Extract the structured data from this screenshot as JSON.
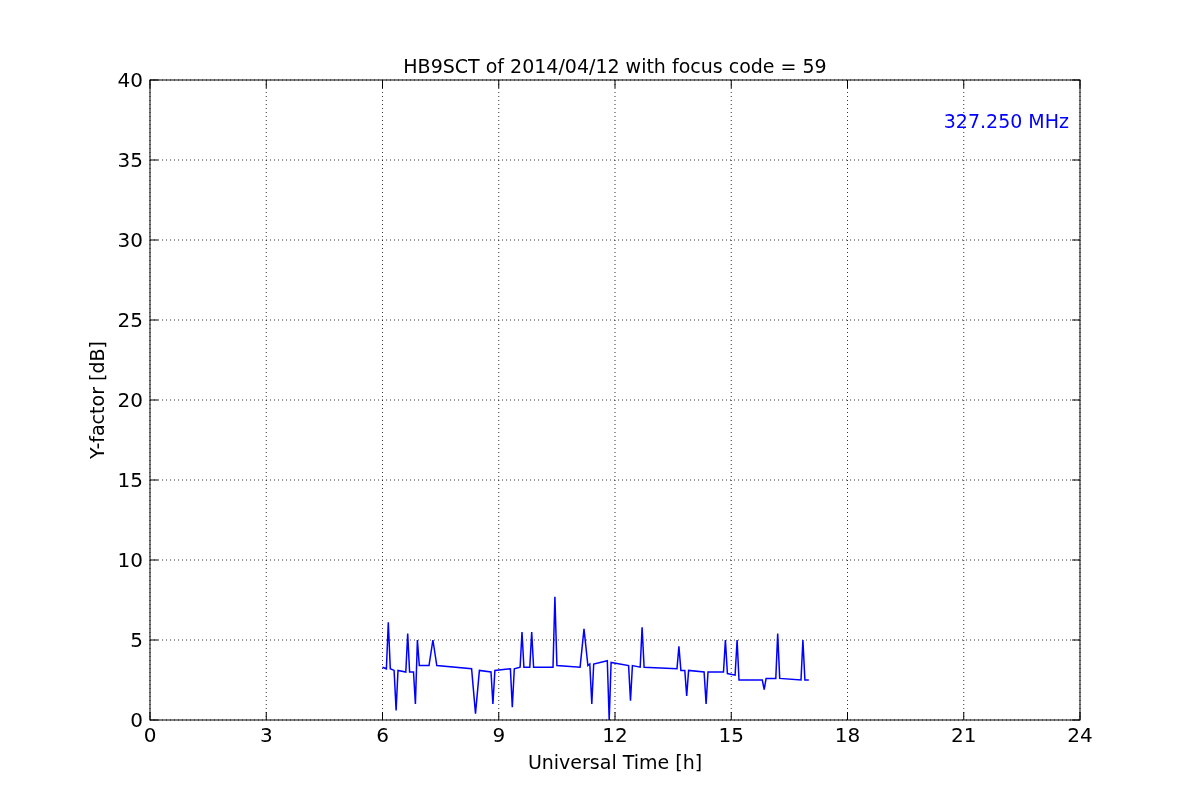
{
  "chart_data": {
    "type": "line",
    "title": "HB9SCT of 2014/04/12 with focus code = 59",
    "xlabel": "Universal Time [h]",
    "ylabel": "Y-factor [dB]",
    "x": [
      6.0,
      6.1,
      6.15,
      6.2,
      6.3,
      6.35,
      6.4,
      6.6,
      6.65,
      6.7,
      6.8,
      6.85,
      6.9,
      6.95,
      7.2,
      7.3,
      7.4,
      8.3,
      8.4,
      8.5,
      8.8,
      8.85,
      8.9,
      9.3,
      9.35,
      9.4,
      9.55,
      9.6,
      9.65,
      9.8,
      9.85,
      9.9,
      10.4,
      10.45,
      10.5,
      11.1,
      11.2,
      11.3,
      11.35,
      11.4,
      11.45,
      11.8,
      11.85,
      11.9,
      12.35,
      12.4,
      12.45,
      12.65,
      12.7,
      12.75,
      13.6,
      13.65,
      13.7,
      13.8,
      13.85,
      13.9,
      14.3,
      14.35,
      14.4,
      14.8,
      14.85,
      14.9,
      15.1,
      15.15,
      15.2,
      15.8,
      15.85,
      15.9,
      16.15,
      16.2,
      16.25,
      16.8,
      16.85,
      16.9,
      17.0
    ],
    "series": [
      {
        "name": "327.250 MHz",
        "color": "#0000ff",
        "values": [
          3.3,
          3.2,
          6.1,
          3.2,
          3.1,
          0.6,
          3.1,
          3.0,
          5.4,
          3.0,
          3.0,
          1.0,
          5.0,
          3.4,
          3.4,
          5.0,
          3.4,
          3.2,
          0.4,
          3.1,
          3.0,
          1.0,
          3.1,
          3.2,
          0.8,
          3.2,
          3.3,
          5.5,
          3.3,
          3.3,
          5.5,
          3.3,
          3.3,
          7.7,
          3.4,
          3.3,
          5.7,
          3.4,
          3.5,
          1.0,
          3.5,
          3.7,
          0.0,
          3.6,
          3.4,
          1.2,
          3.4,
          3.3,
          5.8,
          3.3,
          3.2,
          4.6,
          3.1,
          3.1,
          1.5,
          3.1,
          3.0,
          1.0,
          3.0,
          3.0,
          5.0,
          2.9,
          2.8,
          5.0,
          2.5,
          2.5,
          1.9,
          2.6,
          2.6,
          5.4,
          2.6,
          2.5,
          5.0,
          2.5,
          2.5
        ]
      }
    ],
    "xlim": [
      0,
      24
    ],
    "ylim": [
      0,
      40
    ],
    "xticks": [
      0,
      3,
      6,
      9,
      12,
      15,
      18,
      21,
      24
    ],
    "yticks": [
      0,
      5,
      10,
      15,
      20,
      25,
      30,
      35,
      40
    ],
    "grid": true
  }
}
